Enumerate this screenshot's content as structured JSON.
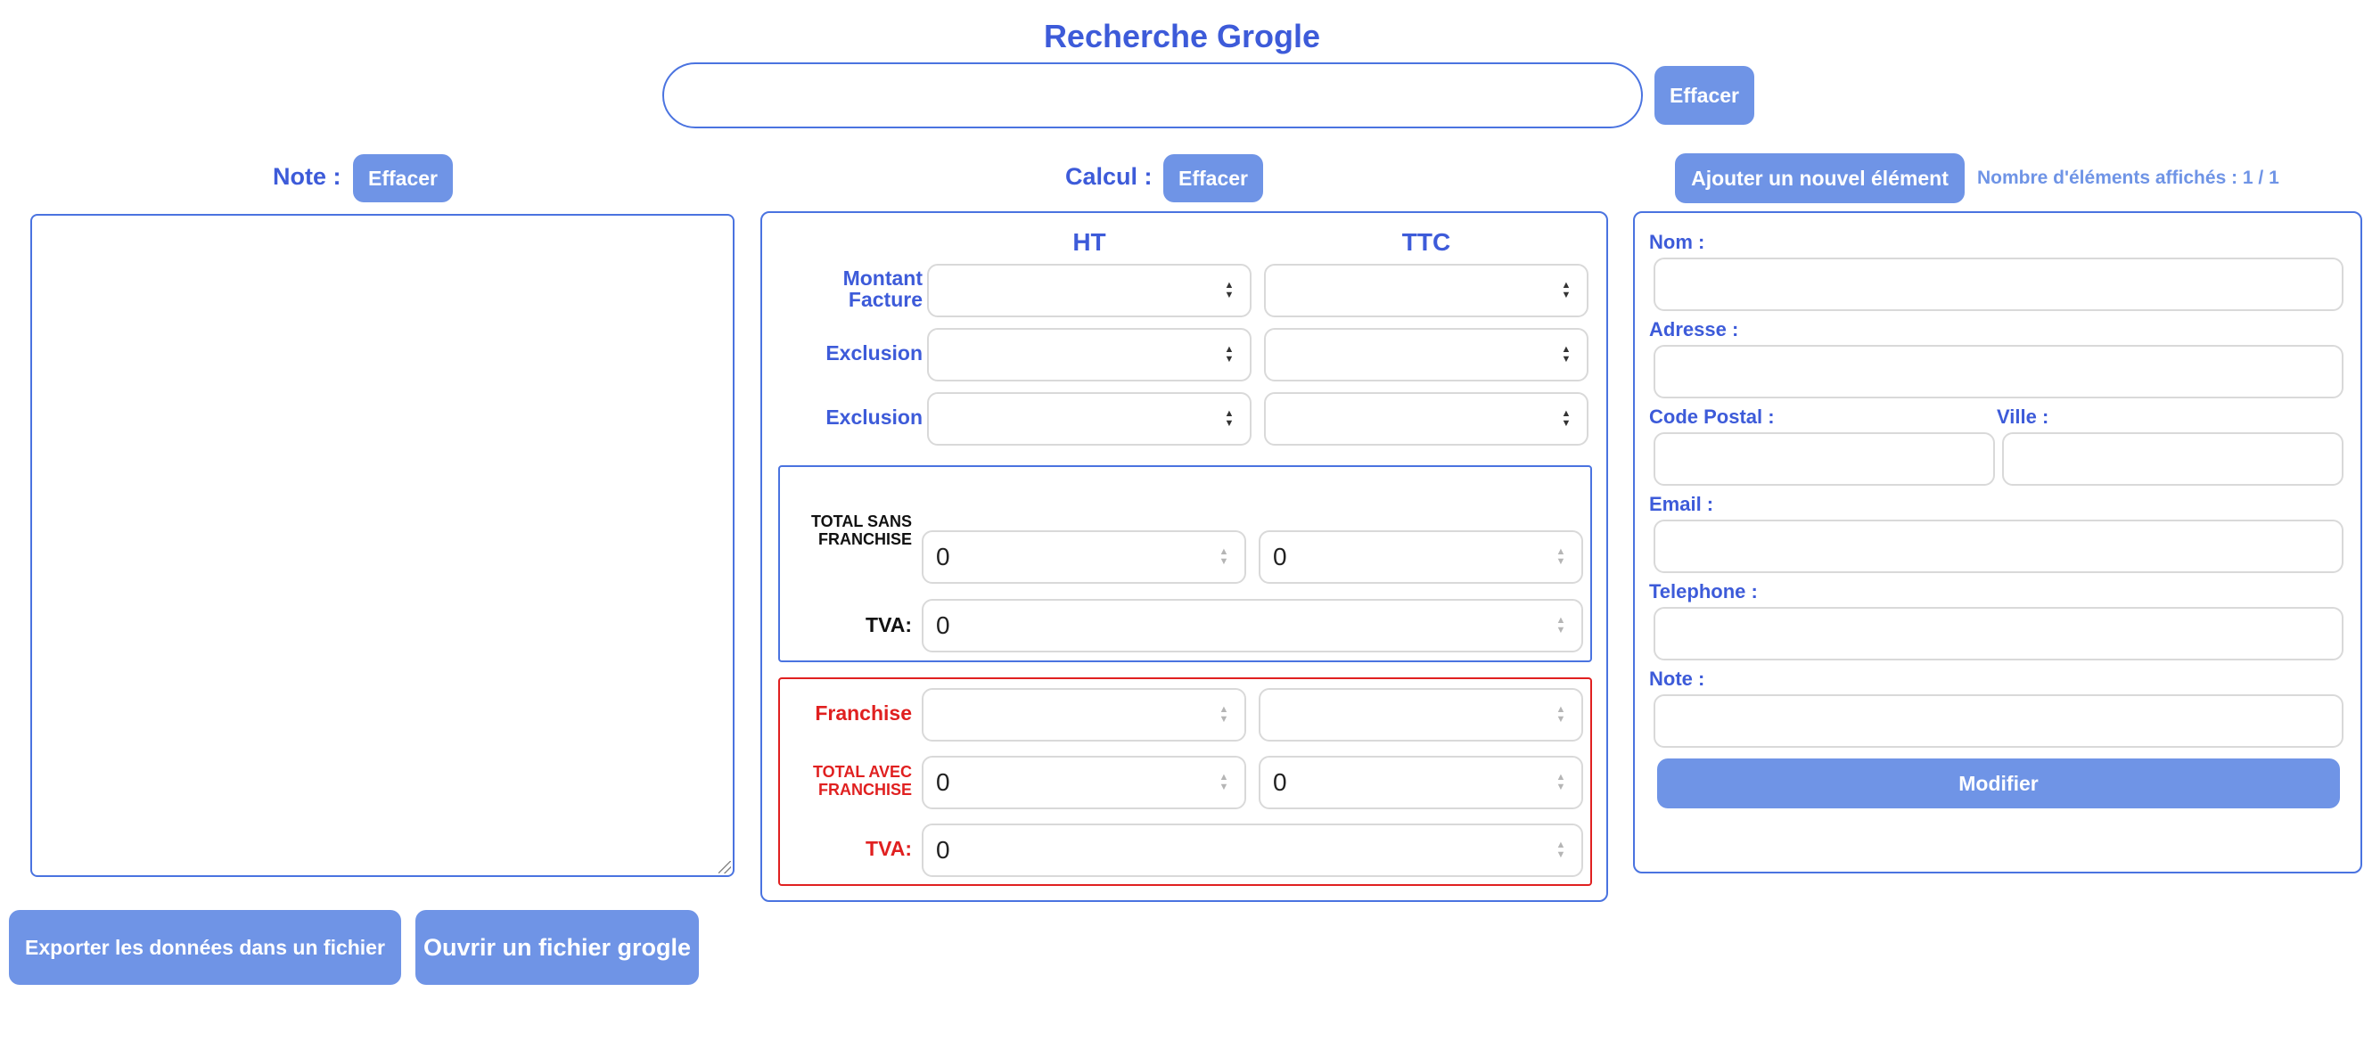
{
  "header": {
    "title": "Recherche Grogle",
    "search_value": "",
    "clear_label": "Effacer"
  },
  "note_section": {
    "label": "Note :",
    "clear_label": "Effacer",
    "content": ""
  },
  "calc_section": {
    "label": "Calcul :",
    "clear_label": "Effacer",
    "columns": [
      "HT",
      "TTC"
    ],
    "input_rows": [
      {
        "label_line1": "Montant",
        "label_line2": "Facture",
        "ht": "",
        "ttc": ""
      },
      {
        "label_line1": "Exclusion",
        "label_line2": "",
        "ht": "",
        "ttc": ""
      },
      {
        "label_line1": "Exclusion",
        "label_line2": "",
        "ht": "",
        "ttc": ""
      }
    ],
    "totals": {
      "label_line1": "TOTAL SANS",
      "label_line2": "FRANCHISE",
      "ht": "0",
      "ttc": "0",
      "tva_label": "TVA:",
      "tva": "0"
    },
    "franchise": {
      "label": "Franchise",
      "ht": "",
      "ttc": "",
      "total_label_line1": "TOTAL AVEC",
      "total_label_line2": "FRANCHISE",
      "total_ht": "0",
      "total_ttc": "0",
      "tva_label": "TVA:",
      "tva": "0"
    },
    "colors": {
      "accent": "#3d5bd9",
      "button": "#6f94e6",
      "danger": "#e02020"
    }
  },
  "contact_section": {
    "add_label": "Ajouter un nouvel élément",
    "count_label": "Nombre d'éléments affichés : 1 / 1",
    "fields": {
      "nom": {
        "label": "Nom :",
        "value": ""
      },
      "adresse": {
        "label": "Adresse :",
        "value": ""
      },
      "code_postal": {
        "label": "Code Postal :",
        "value": ""
      },
      "ville": {
        "label": "Ville :",
        "value": ""
      },
      "email": {
        "label": "Email :",
        "value": ""
      },
      "telephone": {
        "label": "Telephone :",
        "value": ""
      },
      "note": {
        "label": "Note :",
        "value": ""
      }
    },
    "submit_label": "Modifier"
  },
  "footer": {
    "export_label": "Exporter les données dans un fichier",
    "open_label": "Ouvrir un fichier grogle"
  }
}
